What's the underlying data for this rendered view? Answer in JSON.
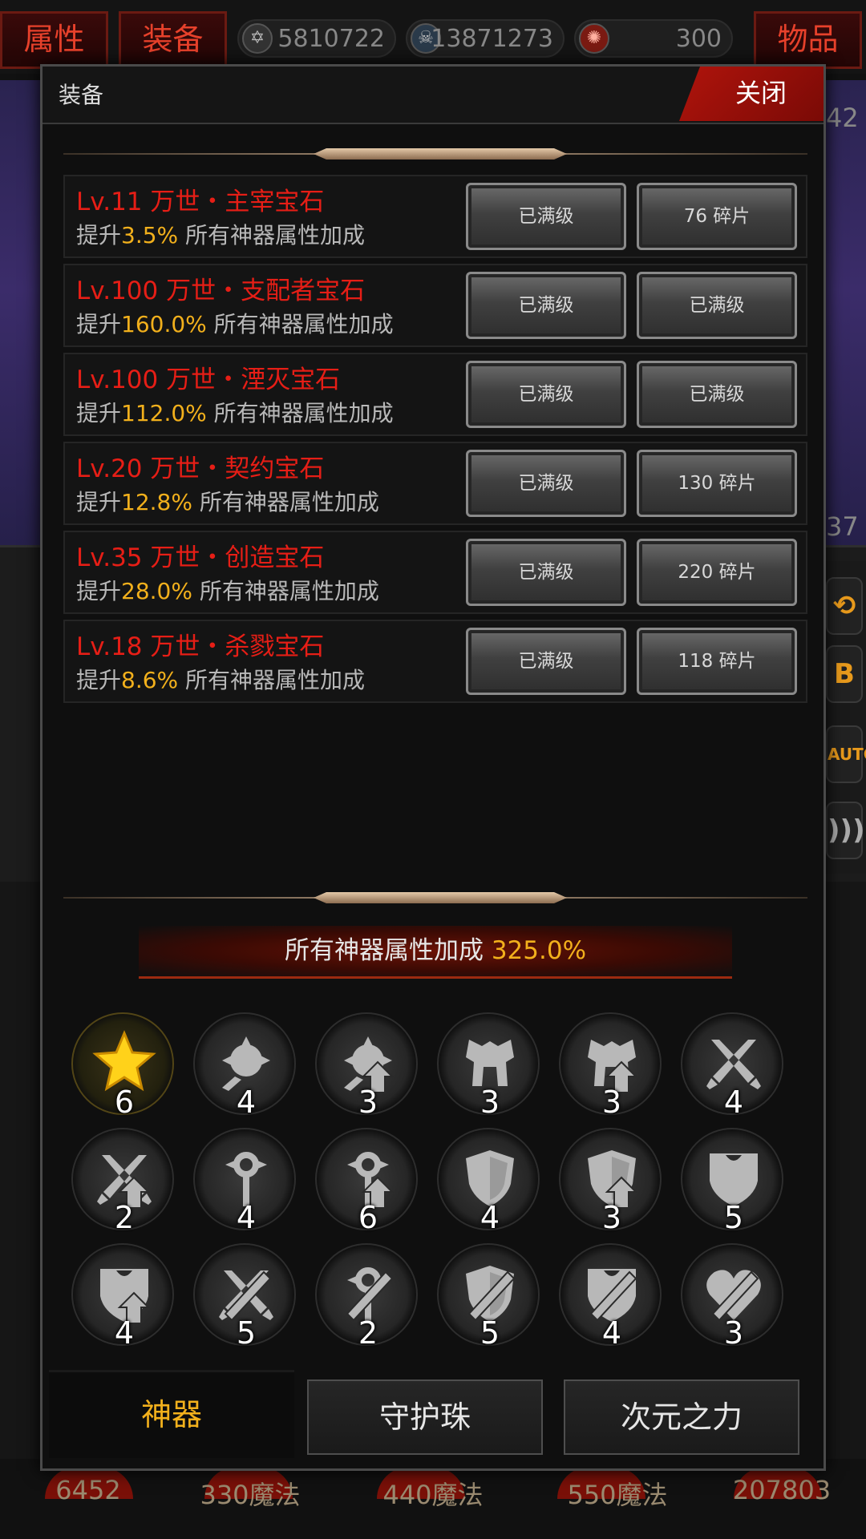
{
  "top_bar": {
    "tabs": [
      "属性",
      "装备",
      "物品"
    ],
    "resources": [
      {
        "icon": "hexagram-coin-icon",
        "value": "5810722"
      },
      {
        "icon": "skull-gem-icon",
        "value": "13871273"
      },
      {
        "icon": "red-swirl-icon",
        "value": "300"
      }
    ]
  },
  "background": {
    "right_num_top": "42",
    "right_num_mid": "37",
    "bottom_items": [
      "6452",
      "330魔法",
      "440魔法",
      "550魔法",
      "207803"
    ]
  },
  "modal": {
    "title": "装备",
    "close_label": "关闭"
  },
  "gems": [
    {
      "name": "Lv.11 万世・主宰宝石",
      "desc_prefix": "提升",
      "pct": "3.5%",
      "desc_suffix": " 所有神器属性加成",
      "btn1": "已满级",
      "btn2": "76 碎片"
    },
    {
      "name": "Lv.100 万世・支配者宝石",
      "desc_prefix": "提升",
      "pct": "160.0%",
      "desc_suffix": " 所有神器属性加成",
      "btn1": "已满级",
      "btn2": "已满级"
    },
    {
      "name": "Lv.100 万世・湮灭宝石",
      "desc_prefix": "提升",
      "pct": "112.0%",
      "desc_suffix": " 所有神器属性加成",
      "btn1": "已满级",
      "btn2": "已满级"
    },
    {
      "name": "Lv.20 万世・契约宝石",
      "desc_prefix": "提升",
      "pct": "12.8%",
      "desc_suffix": " 所有神器属性加成",
      "btn1": "已满级",
      "btn2": "130 碎片"
    },
    {
      "name": "Lv.35 万世・创造宝石",
      "desc_prefix": "提升",
      "pct": "28.0%",
      "desc_suffix": " 所有神器属性加成",
      "btn1": "已满级",
      "btn2": "220 碎片"
    },
    {
      "name": "Lv.18 万世・杀戮宝石",
      "desc_prefix": "提升",
      "pct": "8.6%",
      "desc_suffix": " 所有神器属性加成",
      "btn1": "已满级",
      "btn2": "118 碎片"
    }
  ],
  "bonus": {
    "label": "所有神器属性加成",
    "value": "325.0%"
  },
  "artifacts": [
    {
      "icon": "star-icon",
      "count": "6",
      "gold": true
    },
    {
      "icon": "spiked-mace-icon",
      "count": "4"
    },
    {
      "icon": "spiked-mace-upgrade-icon",
      "count": "3"
    },
    {
      "icon": "armor-icon",
      "count": "3"
    },
    {
      "icon": "armor-upgrade-icon",
      "count": "3"
    },
    {
      "icon": "crossed-swords-icon",
      "count": "4"
    },
    {
      "icon": "crossed-swords-upgrade-icon",
      "count": "2"
    },
    {
      "icon": "scepter-icon",
      "count": "4"
    },
    {
      "icon": "scepter-upgrade-icon",
      "count": "6"
    },
    {
      "icon": "shield-icon",
      "count": "4"
    },
    {
      "icon": "shield-upgrade-icon",
      "count": "3"
    },
    {
      "icon": "heart-shield-icon",
      "count": "5"
    },
    {
      "icon": "heart-shield-upgrade-icon",
      "count": "4"
    },
    {
      "icon": "slashed-swords-icon",
      "count": "5"
    },
    {
      "icon": "slashed-scepter-icon",
      "count": "2"
    },
    {
      "icon": "slashed-shield-icon",
      "count": "5"
    },
    {
      "icon": "slashed-heart-shield-icon",
      "count": "4"
    },
    {
      "icon": "slashed-heart-icon",
      "count": "3"
    }
  ],
  "tabs": [
    "神器",
    "守护珠",
    "次元之力"
  ]
}
